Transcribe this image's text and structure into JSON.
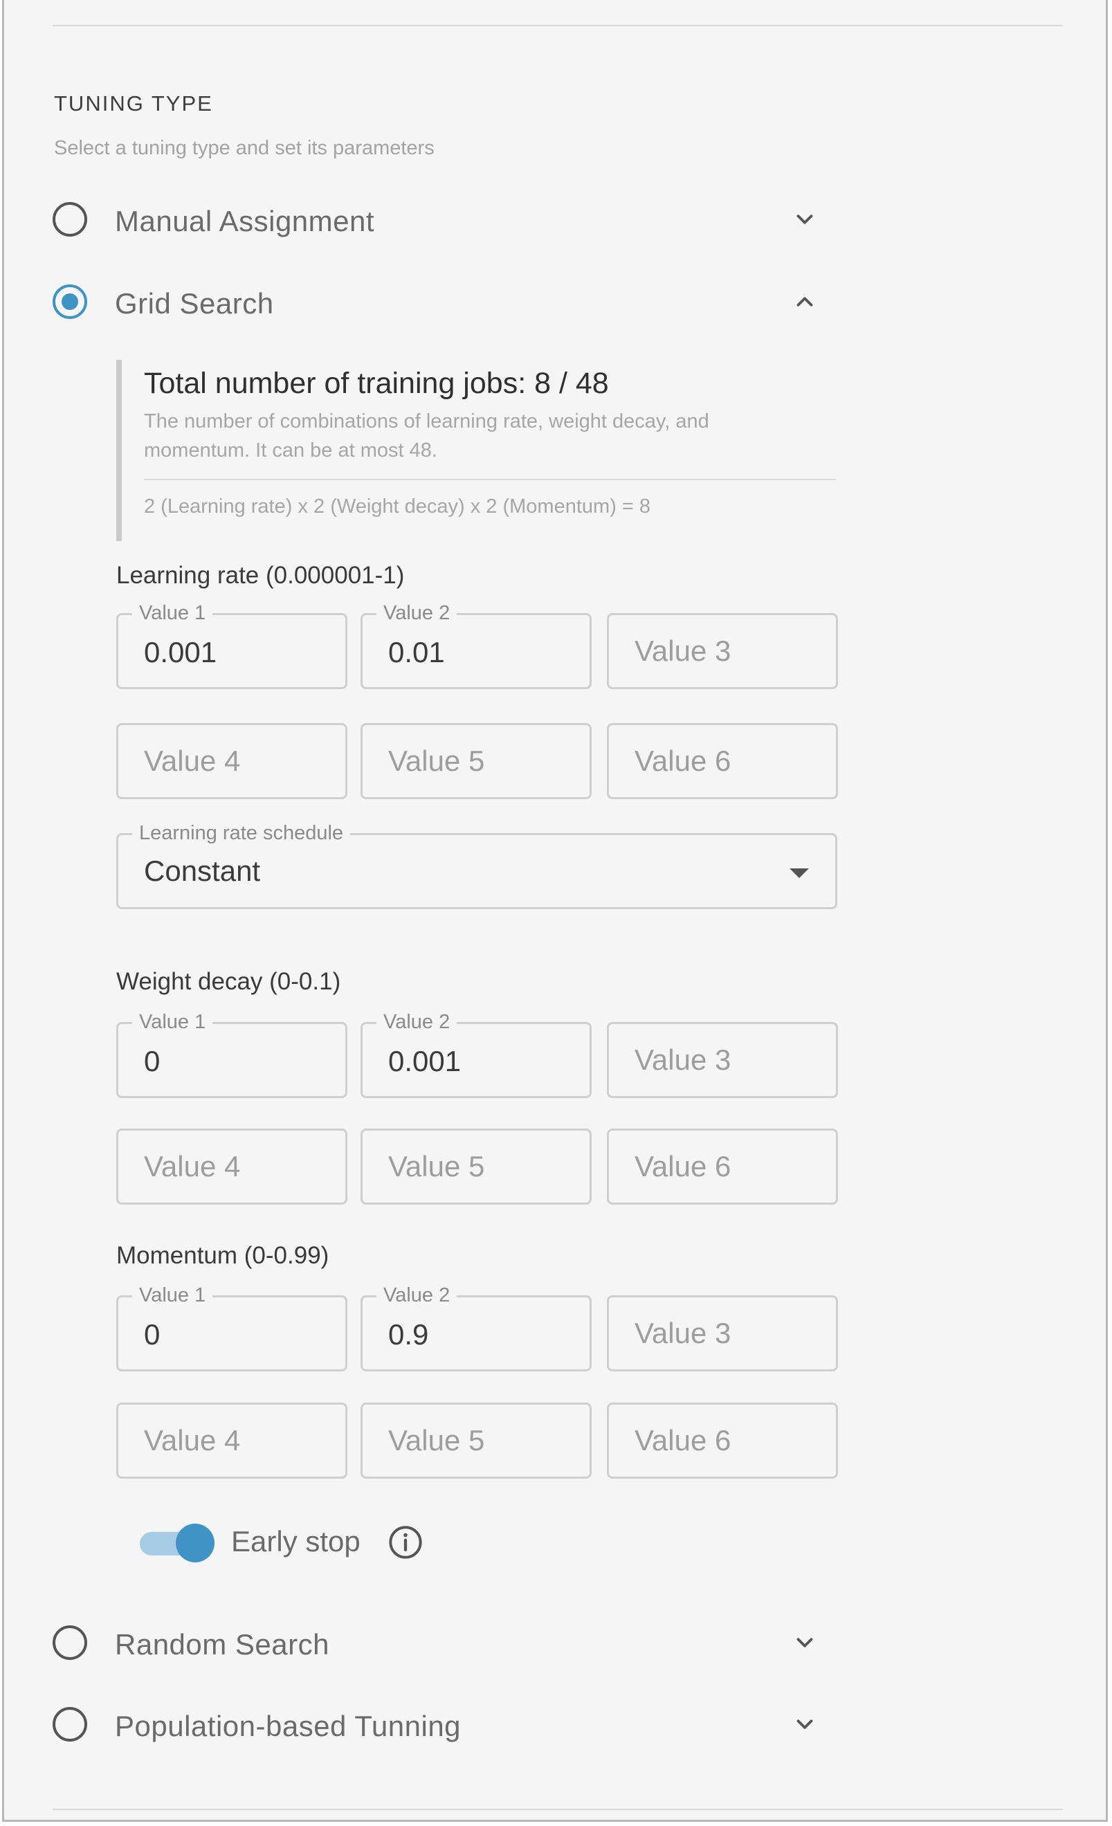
{
  "section": {
    "title": "TUNING TYPE",
    "subtitle": "Select a tuning type and set its parameters"
  },
  "options": {
    "manual": {
      "label": "Manual Assignment",
      "selected": false,
      "icon": "chevron-down-icon"
    },
    "grid": {
      "label": "Grid Search",
      "selected": true,
      "icon": "chevron-up-icon"
    },
    "random": {
      "label": "Random Search",
      "selected": false,
      "icon": "chevron-down-icon"
    },
    "population": {
      "label": "Population-based Tunning",
      "selected": false,
      "icon": "chevron-down-icon"
    }
  },
  "summary": {
    "title": "Total number of training jobs: 8 / 48",
    "description": "The number of combinations of learning rate, weight decay, and momentum. It can be at most 48.",
    "formula": "2 (Learning rate) x 2 (Weight decay) x 2 (Momentum) = 8"
  },
  "learning_rate": {
    "label": "Learning rate (0.000001-1)",
    "fields": [
      {
        "legend": "Value 1",
        "value": "0.001",
        "placeholder": ""
      },
      {
        "legend": "Value 2",
        "value": "0.01",
        "placeholder": ""
      },
      {
        "legend": "",
        "value": "",
        "placeholder": "Value 3"
      },
      {
        "legend": "",
        "value": "",
        "placeholder": "Value 4"
      },
      {
        "legend": "",
        "value": "",
        "placeholder": "Value 5"
      },
      {
        "legend": "",
        "value": "",
        "placeholder": "Value 6"
      }
    ],
    "schedule": {
      "legend": "Learning rate schedule",
      "value": "Constant"
    }
  },
  "weight_decay": {
    "label": "Weight decay (0-0.1)",
    "fields": [
      {
        "legend": "Value 1",
        "value": "0",
        "placeholder": ""
      },
      {
        "legend": "Value 2",
        "value": "0.001",
        "placeholder": ""
      },
      {
        "legend": "",
        "value": "",
        "placeholder": "Value 3"
      },
      {
        "legend": "",
        "value": "",
        "placeholder": "Value 4"
      },
      {
        "legend": "",
        "value": "",
        "placeholder": "Value 5"
      },
      {
        "legend": "",
        "value": "",
        "placeholder": "Value 6"
      }
    ]
  },
  "momentum": {
    "label": "Momentum (0-0.99)",
    "fields": [
      {
        "legend": "Value 1",
        "value": "0",
        "placeholder": ""
      },
      {
        "legend": "Value 2",
        "value": "0.9",
        "placeholder": ""
      },
      {
        "legend": "",
        "value": "",
        "placeholder": "Value 3"
      },
      {
        "legend": "",
        "value": "",
        "placeholder": "Value 4"
      },
      {
        "legend": "",
        "value": "",
        "placeholder": "Value 5"
      },
      {
        "legend": "",
        "value": "",
        "placeholder": "Value 6"
      }
    ]
  },
  "early_stop": {
    "label": "Early stop",
    "enabled": true,
    "icon": "info-icon"
  },
  "colors": {
    "accent": "#3f94c5",
    "toggle_track": "#a6cde5",
    "panel_bg": "#f5f5f5"
  }
}
